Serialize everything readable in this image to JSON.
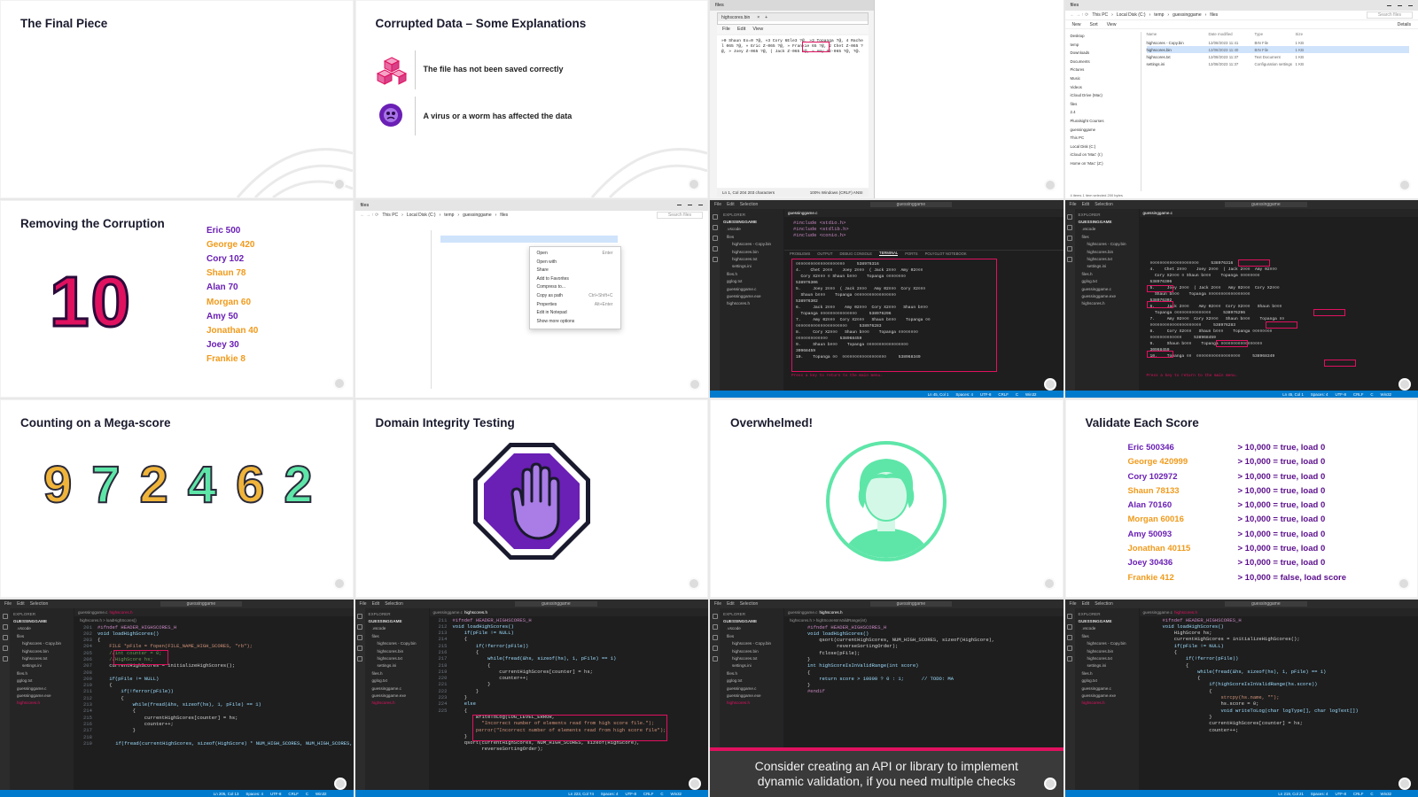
{
  "colors": {
    "magenta": "#e0115f",
    "purple": "#6a1fb5",
    "orange": "#f09a1a",
    "green": "#2ecc71",
    "mint": "#5ee6a8",
    "vscode_bg": "#1e1e1e",
    "vscode_status": "#007acc"
  },
  "t1": {
    "title": "The Final Piece"
  },
  "t2": {
    "title": "Corrupted Data – Some Explanations",
    "item1": "The file has not been saved correctly",
    "item2": "A virus or a worm has affected the data",
    "icon1": "cubes-icon",
    "icon2": "virus-icon"
  },
  "t3": {
    "window_title": "files",
    "tab": "highscores.bin",
    "menu": [
      "File",
      "Edit",
      "View"
    ],
    "content": "»0 Shaun Eo=0 ?@, »3 Cory 6Ele3 ?@, »3 Topanga ?@, 4 Rachel 065 ?@, » Eric Z-065 ?@, » Frankie 65 ?@, 2 Chet Z-065 ?@, » Joey Z-065 ?@, ( Jack Z-065 ?@, » Amy #2-065 ?@, ?@.",
    "status_left": "Ln 1, Col 204   203 characters",
    "status_right": "100%   Windows (CRLF)   ANSI"
  },
  "t4": {
    "window_title": "files",
    "path": [
      "This PC",
      "Local Disk (C:)",
      "temp",
      "guessinggame",
      "files"
    ],
    "search": "Search files",
    "toolbar": [
      "New",
      "Sort",
      "View",
      "Details"
    ],
    "headers": [
      "Name",
      "Date modified",
      "Type",
      "Size"
    ],
    "files": [
      {
        "name": "highscores - Copy.bin",
        "date": "12/08/2023 11:41",
        "type": "BIN File",
        "size": "1 KB"
      },
      {
        "name": "highscores.bin",
        "date": "12/08/2023 11:40",
        "type": "BIN File",
        "size": "1 KB"
      },
      {
        "name": "highscores.txt",
        "date": "12/08/2023 11:37",
        "type": "Text Document",
        "size": "1 KB"
      },
      {
        "name": "settings.ini",
        "date": "12/08/2023 11:37",
        "type": "Configuration settings",
        "size": "1 KB"
      }
    ],
    "nav": [
      "Desktop",
      "temp",
      "Downloads",
      "Documents",
      "Pictures",
      "Music",
      "Videos",
      "iCloud Drive (Mac)",
      "files",
      "2.4",
      "Pluralsight Courses",
      "guessinggame",
      "This PC",
      "Local Disk (C:)",
      "iCloud on 'Mac' (I:)",
      "Home on 'Mac' (Z:)"
    ],
    "footer": "4 items   1 item selected  200 bytes"
  },
  "t5": {
    "title": "Removing the Corruption",
    "big_number": "10",
    "scores": [
      "Eric 500",
      "George 420",
      "Cory 102",
      "Shaun 78",
      "Alan 70",
      "Morgan 60",
      "Amy 50",
      "Jonathan 40",
      "Joey 30",
      "Frankie 8"
    ]
  },
  "t6": {
    "window_title": "files",
    "path": [
      "This PC",
      "Local Disk (C:)",
      "temp",
      "guessinggame",
      "files"
    ],
    "search": "Search files",
    "menu_items": [
      {
        "label": "Open",
        "shortcut": "Enter"
      },
      {
        "label": "Open with",
        "shortcut": ""
      },
      {
        "label": "Share",
        "shortcut": ""
      },
      {
        "label": "Add to Favorites",
        "shortcut": ""
      },
      {
        "label": "Compress to...",
        "shortcut": ""
      },
      {
        "label": "Copy as path",
        "shortcut": "Ctrl+Shift+C"
      },
      {
        "label": "Properties",
        "shortcut": "Alt+Enter"
      },
      {
        "label": "Edit in Notepad",
        "shortcut": ""
      },
      {
        "label": "Show more options",
        "shortcut": ""
      }
    ]
  },
  "t7": {
    "search": "guessinggame",
    "explorer_title": "EXPLORER",
    "project": "GUESSINGGAME",
    "tree": [
      ".vscode",
      "files",
      "highscores - Copy.bin",
      "highscores.bin",
      "highscores.txt",
      "settings.ini",
      "files.h",
      "gglog.txt",
      "guessinggame.c",
      "guessinggame.exe",
      "highscores.h"
    ],
    "tab": "guessinggame.c",
    "panel_tabs": [
      "PROBLEMS",
      "OUTPUT",
      "DEBUG CONSOLE",
      "TERMINAL",
      "PORTS",
      "POLYGLOT NOTEBOOK"
    ],
    "code": [
      "#include <stdio.h>",
      "#include <stdlib.h>",
      "#include <conio.h>"
    ],
    "terminal": [
      "¤¤¤¤¤¤¤¤¤¤¤¤¤¤¤¤¤¤¤¤     538976316",
      "4.    Chet 2¤¤¤    Joey 2¤¤¤  ( Jack 2¤¤¤  Amy 02¤¤¤",
      "  Cory X2¤¤¤ ¤ Shaun b¤¤¤    Topanga ¤¤¤¤¤¤¤¤",
      "538976306",
      "5.     Joey 2¤¤¤  ( Jack 2¤¤¤   Amy 02¤¤¤  Cory X2¤¤¤",
      "  Shaun b¤¤¤    Topanga ¤¤¤¤¤¤¤¤¤¤¤¤¤¤¤¤¤",
      "538976302",
      "6.     Jack 2¤¤¤    Amy 02¤¤¤  Cory X2¤¤¤   Shaun b¤¤¤",
      "  Topanga ¤¤¤¤¤¤¤¤¤¤¤¤¤¤¤     538976296",
      "7.     Amy 02¤¤¤  Cory X2¤¤¤   Shaun b¤¤¤    Topanga ¤¤",
      "¤¤¤¤¤¤¤¤¤¤¤¤¤¤¤¤¤¤¤¤¤     538976283",
      "8.     Cory X2¤¤¤   Shaun b¤¤¤    Topanga ¤¤¤¤¤¤¤¤",
      "¤¤¤¤¤¤¤¤¤¤¤¤¤     538968459",
      "9.     Shaun b¤¤¤    Topanga ¤¤¤¤¤¤¤¤¤¤¤¤¤¤¤¤¤",
      "30968459",
      "10.    Topanga ¤¤  ¤¤¤¤¤¤¤¤¤¤¤¤¤¤¤¤¤¤     538968349"
    ],
    "prompt": "Press a key to return to the main menu.",
    "status": [
      "Ln 45, Col 1",
      "Spaces: 4",
      "UTF-8",
      "CRLF",
      "C",
      "Win32"
    ]
  },
  "t9": {
    "title": "Counting on a Mega-score",
    "digits": [
      "9",
      "7",
      "2",
      "4",
      "6",
      "2"
    ]
  },
  "t10": {
    "title": "Domain Integrity Testing",
    "icon": "stop-hand-icon"
  },
  "t11": {
    "title": "Overwhelmed!",
    "icon": "person-avatar-icon"
  },
  "t12": {
    "title": "Validate Each Score",
    "rows": [
      {
        "name": "Eric 500346",
        "result": "> 10,000 = true, load 0"
      },
      {
        "name": "George 420999",
        "result": "> 10,000 = true, load 0"
      },
      {
        "name": "Cory 102972",
        "result": "> 10,000 = true, load 0"
      },
      {
        "name": "Shaun 78133",
        "result": "> 10,000 = true, load 0"
      },
      {
        "name": "Alan 70160",
        "result": "> 10,000 = true, load 0"
      },
      {
        "name": "Morgan 60016",
        "result": "> 10,000 = true, load 0"
      },
      {
        "name": "Amy 50093",
        "result": "> 10,000 = true, load 0"
      },
      {
        "name": "Jonathan 40115",
        "result": "> 10,000 = true, load 0"
      },
      {
        "name": "Joey 30436",
        "result": "> 10,000 = true, load 0"
      },
      {
        "name": "Frankie 412",
        "result": "> 10,000 = false, load score"
      }
    ]
  },
  "t13": {
    "tab1": "guessinggame.c",
    "tab2": "highscores.h",
    "breadcrumb": "highscores.h > loadHighScores()",
    "lines": [
      "201",
      "202",
      "203",
      "204",
      "205",
      "206",
      "207",
      "208",
      "209",
      "210",
      "211",
      "212",
      "213",
      "214",
      "215",
      "216",
      "217",
      "218",
      "219"
    ],
    "code": [
      "#ifndef HEADER_HIGHSCORES_H",
      "void loadHighScores()",
      "{",
      "    FILE *pFile = fopen(FILE_NAME_HIGH_SCORES, \"rb\");",
      "    //int counter = 0;",
      "    //HighScore hs;",
      "    currentHighScores = initializeHighScores();",
      "",
      "    if(pFile != NULL)",
      "    {",
      "        if(!ferror(pFile))",
      "        {",
      "            while(fread(&hs, sizeof(hs), 1, pFile) == 1)",
      "            {",
      "                currentHighScores[counter] = hs;",
      "                counter++;",
      "            }",
      "",
      "        if(fread(currentHighScores, sizeof(HighScore) * NUM_HIGH_SCORES, NUM_HIGH_SCORES, pFile) != NUM_HIGH_SCORES)"
    ],
    "status": [
      "Ln 205, Col 13",
      "Spaces: 4",
      "UTF-8",
      "CRLF",
      "C",
      "Win32"
    ]
  },
  "t14": {
    "lines": [
      "211",
      "212",
      "213",
      "214",
      "215",
      "216",
      "217",
      "218",
      "219",
      "220",
      "221",
      "222",
      "223",
      "224",
      "225"
    ],
    "code": [
      "#ifndef HEADER_HIGHSCORES_H",
      "void loadHighScores()",
      "    if(pFile != NULL)",
      "    {",
      "        if(!ferror(pFile))",
      "        {",
      "            while(fread(&hs, sizeof(hs), 1, pFile) == 1)",
      "            {",
      "                currentHighScores[counter] = hs;",
      "                counter++;",
      "            }",
      "        }",
      "    }",
      "    else",
      "    {",
      "        writeToLog(LOG_LEVEL_ERROR,",
      "          \"Incorrect number of elements read from high score file.\");",
      "        perror(\"Incorrect number of elements read from high score file\");",
      "    }",
      "",
      "    qsort(currentHighScores, NUM_HIGH_SCORES, sizeof(HighScore),",
      "          reverseSortingOrder);"
    ],
    "status": [
      "Ln 223, Col 74",
      "Spaces: 4",
      "UTF-8",
      "CRLF",
      "C",
      "Win32"
    ]
  },
  "t15": {
    "breadcrumb": "highscores.h > highScoreIsInValidRange(int)",
    "code": [
      "#ifndef HEADER_HIGHSCORES_H",
      "void loadHighScores()",
      "",
      "    qsort(currentHighScores, NUM_HIGH_SCORES, sizeof(HighScore),",
      "          reverseSortingOrder);",
      "",
      "    fclose(pFile);",
      "}",
      "",
      "int highScoreIsInValidRange(int score)",
      "{",
      "    return score > 10000 ? 0 : 1;      // TODO: MA",
      "}",
      "",
      "#endif"
    ],
    "caption": "Consider creating an API or library to implement dynamic validation, if you need multiple checks"
  },
  "t16": {
    "code": [
      "#ifndef HEADER_HIGHSCORES_H",
      "void loadHighScores()",
      "    HighScore hs;",
      "    currentHighScores = initializeHighScores();",
      "",
      "    if(pFile != NULL)",
      "    {",
      "        if(!ferror(pFile))",
      "        {",
      "            while(fread(&hs, sizeof(hs), 1, pFile) == 1)",
      "            {",
      "                if(highScoreIsInValidRange(hs.score))",
      "                {",
      "                    strcpy(hs.name, \"\");",
      "                    hs.score = 0;",
      "                    void writeToLog(char logType[], char logText[])",
      "                }",
      "",
      "                currentHighScores[counter] = hs;",
      "                counter++;"
    ],
    "status": [
      "Ln 219, Col 21",
      "Spaces: 4",
      "UTF-8",
      "CRLF",
      "C",
      "Win32"
    ]
  }
}
